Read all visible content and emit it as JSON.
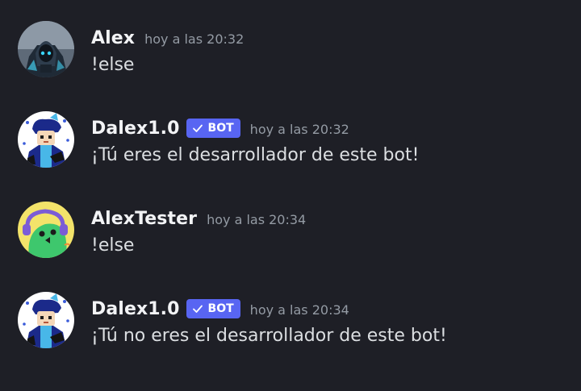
{
  "messages": [
    {
      "author": "Alex",
      "is_bot": false,
      "timestamp": "hoy a las 20:32",
      "content": "!else",
      "avatar_icon": "hooded-figure-avatar"
    },
    {
      "author": "Dalex1.0",
      "is_bot": true,
      "bot_tag": "BOT",
      "timestamp": "hoy a las 20:32",
      "content": "¡Tú eres el desarrollador de este bot!",
      "avatar_icon": "character-avatar"
    },
    {
      "author": "AlexTester",
      "is_bot": false,
      "timestamp": "hoy a las 20:34",
      "content": "!else",
      "avatar_icon": "green-creature-avatar"
    },
    {
      "author": "Dalex1.0",
      "is_bot": true,
      "bot_tag": "BOT",
      "timestamp": "hoy a las 20:34",
      "content": "¡Tú no eres el desarrollador de este bot!",
      "avatar_icon": "character-avatar"
    }
  ],
  "colors": {
    "background": "#1e1f26",
    "username": "#f2f3f5",
    "timestamp": "#949ba4",
    "text": "#dbdee1",
    "bot_tag": "#5865f2"
  }
}
